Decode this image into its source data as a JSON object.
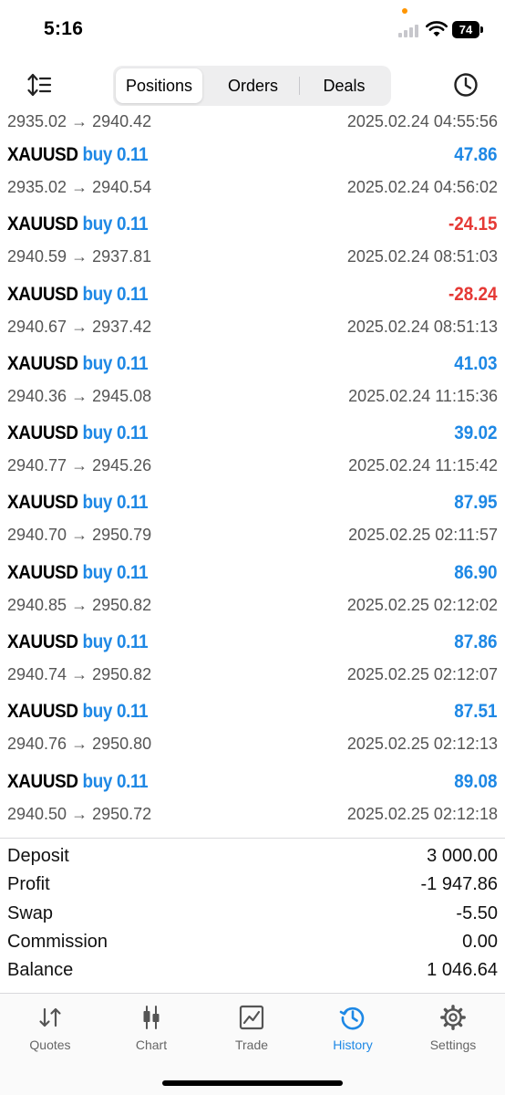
{
  "status_bar": {
    "time": "5:16",
    "battery": "74"
  },
  "toolbar": {
    "tabs": [
      {
        "label": "Positions",
        "active": true
      },
      {
        "label": "Orders",
        "active": false
      },
      {
        "label": "Deals",
        "active": false
      }
    ]
  },
  "partial_trade": {
    "prices": "2935.02 → 2940.42",
    "datetime": "2025.02.24 04:55:56"
  },
  "trades": [
    {
      "symbol": "XAUUSD",
      "side": "buy 0.11",
      "profit": "47.86",
      "prices": "2935.02 → 2940.54",
      "datetime": "2025.02.24 04:56:02"
    },
    {
      "symbol": "XAUUSD",
      "side": "buy 0.11",
      "profit": "-24.15",
      "prices": "2940.59 → 2937.81",
      "datetime": "2025.02.24 08:51:03"
    },
    {
      "symbol": "XAUUSD",
      "side": "buy 0.11",
      "profit": "-28.24",
      "prices": "2940.67 → 2937.42",
      "datetime": "2025.02.24 08:51:13"
    },
    {
      "symbol": "XAUUSD",
      "side": "buy 0.11",
      "profit": "41.03",
      "prices": "2940.36 → 2945.08",
      "datetime": "2025.02.24 11:15:36"
    },
    {
      "symbol": "XAUUSD",
      "side": "buy 0.11",
      "profit": "39.02",
      "prices": "2940.77 → 2945.26",
      "datetime": "2025.02.24 11:15:42"
    },
    {
      "symbol": "XAUUSD",
      "side": "buy 0.11",
      "profit": "87.95",
      "prices": "2940.70 → 2950.79",
      "datetime": "2025.02.25 02:11:57"
    },
    {
      "symbol": "XAUUSD",
      "side": "buy 0.11",
      "profit": "86.90",
      "prices": "2940.85 → 2950.82",
      "datetime": "2025.02.25 02:12:02"
    },
    {
      "symbol": "XAUUSD",
      "side": "buy 0.11",
      "profit": "87.86",
      "prices": "2940.74 → 2950.82",
      "datetime": "2025.02.25 02:12:07"
    },
    {
      "symbol": "XAUUSD",
      "side": "buy 0.11",
      "profit": "87.51",
      "prices": "2940.76 → 2950.80",
      "datetime": "2025.02.25 02:12:13"
    },
    {
      "symbol": "XAUUSD",
      "side": "buy 0.11",
      "profit": "89.08",
      "prices": "2940.50 → 2950.72",
      "datetime": "2025.02.25 02:12:18"
    }
  ],
  "summary": [
    {
      "label": "Deposit",
      "value": "3 000.00"
    },
    {
      "label": "Profit",
      "value": "-1 947.86"
    },
    {
      "label": "Swap",
      "value": "-5.50"
    },
    {
      "label": "Commission",
      "value": "0.00"
    },
    {
      "label": "Balance",
      "value": "1 046.64"
    }
  ],
  "tabbar": [
    {
      "label": "Quotes",
      "icon": "quotes-icon",
      "active": false
    },
    {
      "label": "Chart",
      "icon": "chart-icon",
      "active": false
    },
    {
      "label": "Trade",
      "icon": "trade-icon",
      "active": false
    },
    {
      "label": "History",
      "icon": "history-icon",
      "active": true
    },
    {
      "label": "Settings",
      "icon": "settings-icon",
      "active": false
    }
  ],
  "colors": {
    "accent": "#1e88e5",
    "negative": "#e53935",
    "secondary_text": "#555555"
  }
}
